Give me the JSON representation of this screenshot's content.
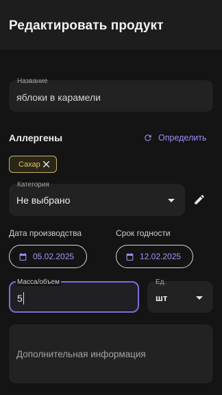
{
  "appbar": {
    "title": "Редактировать продукт"
  },
  "name_field": {
    "label": "Название",
    "value": "яблоки в карамели"
  },
  "allergens": {
    "title": "Аллергены",
    "detect_label": "Определить",
    "chips": [
      {
        "label": "Сахар"
      }
    ]
  },
  "category": {
    "label": "Категория",
    "value": "Не выбрано"
  },
  "dates": {
    "production_label": "Дата производства",
    "production_value": "05.02.2025",
    "expiry_label": "Срок годности",
    "expiry_value": "12.02.2025"
  },
  "mass": {
    "label": "Масса/объем",
    "value": "5"
  },
  "unit": {
    "label": "Ед.",
    "value": "шт"
  },
  "extra": {
    "placeholder": "Дополнительная информация"
  },
  "colors": {
    "accent": "#9d8cf5",
    "focus_border": "#7f6de0",
    "chip_gold": "#e7c35a",
    "background": "#141414"
  }
}
